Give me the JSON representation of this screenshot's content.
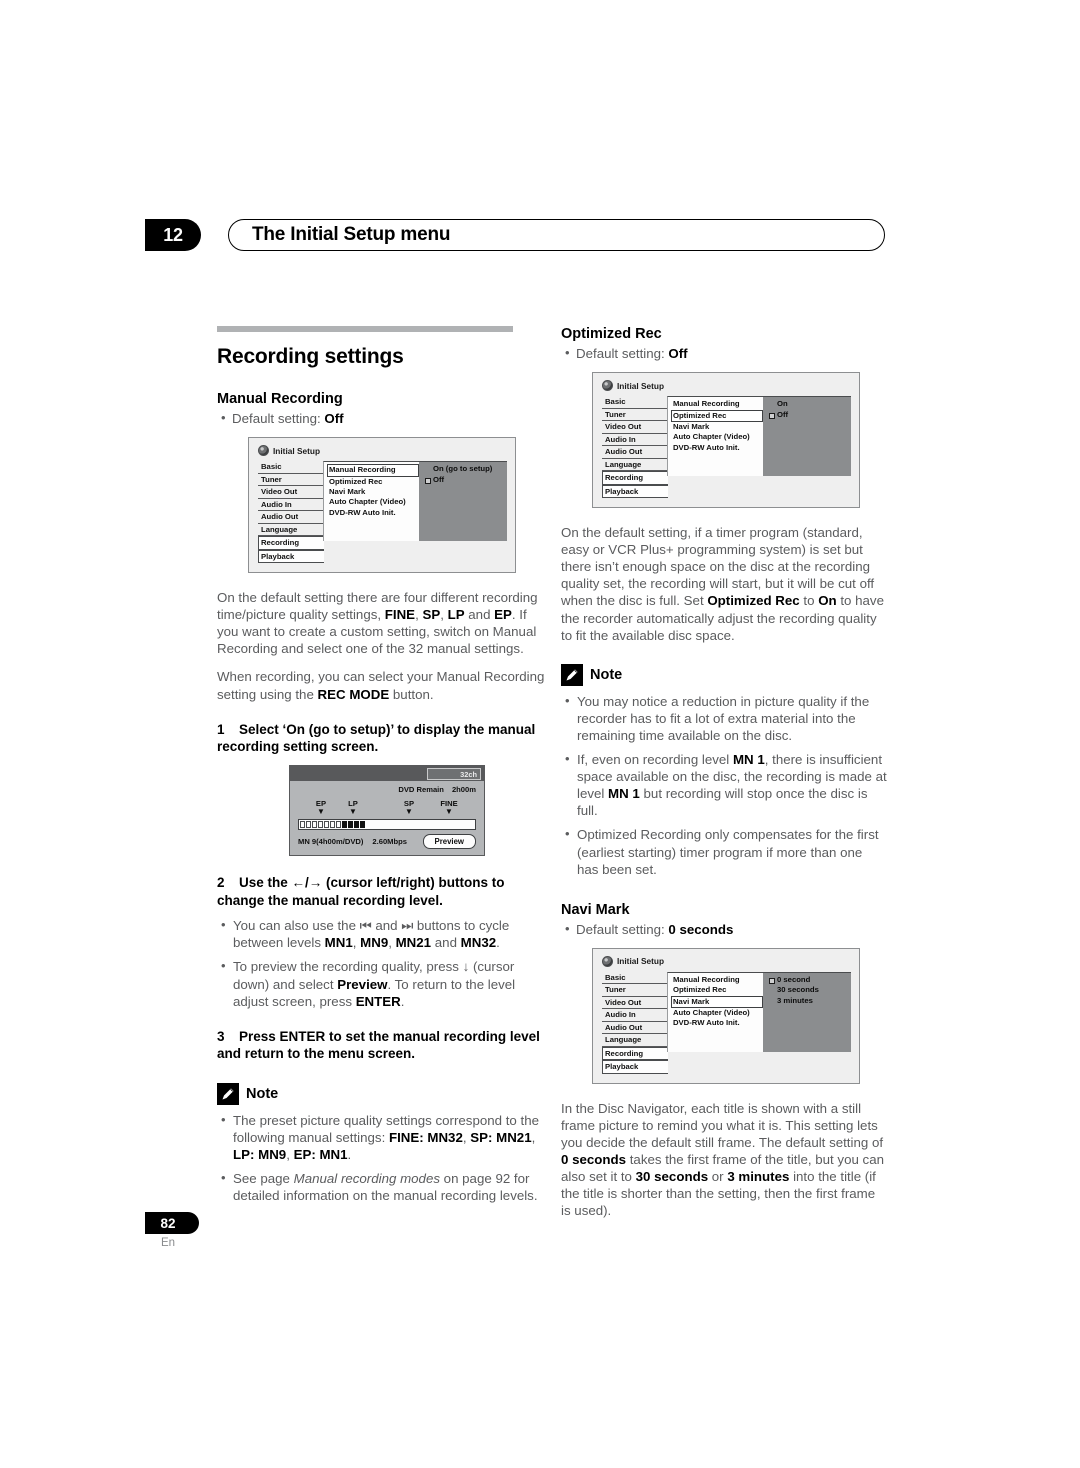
{
  "header": {
    "chapter_number": "12",
    "title": "The Initial Setup menu"
  },
  "footer": {
    "page_number": "82",
    "language_code": "En"
  },
  "left_column": {
    "section_title": "Recording settings",
    "manual_recording": {
      "heading": "Manual Recording",
      "default_setting": "Default setting: ",
      "default_value": "Off",
      "osd": {
        "title": "Initial Setup",
        "categories": [
          "Basic",
          "Tuner",
          "Video Out",
          "Audio In",
          "Audio Out",
          "Language",
          "Recording",
          "Playback"
        ],
        "selected_category": "Recording",
        "items": [
          "Manual Recording",
          "Optimized Rec",
          "Navi Mark",
          "Auto Chapter (Video)",
          "DVD-RW Auto Init."
        ],
        "selected_item": "Manual Recording",
        "options": [
          "On (go to setup)",
          "Off"
        ],
        "selected_option": "Off"
      },
      "para1_a": "On the default setting there are four different recording time/picture quality settings, ",
      "para1_fine": "FINE",
      "para1_b": ", ",
      "para1_sp": "SP",
      "para1_c": ", ",
      "para1_lp": "LP",
      "para1_d": " and ",
      "para1_ep": "EP",
      "para1_e": ". If you want to create a custom setting, switch on Manual Recording and select one of the 32 manual settings.",
      "para2_a": "When recording, you can select your Manual Recording setting using the ",
      "para2_recmode": "REC MODE",
      "para2_b": " button.",
      "step1_num": "1",
      "step1_text": "Select ‘On (go to setup)’ to display the manual recording setting screen.",
      "level_screen": {
        "channel": "32ch",
        "remain_label": "DVD Remain",
        "remain_value": "2h00m",
        "marks": [
          "EP",
          "LP",
          "SP",
          "FINE"
        ],
        "mode_label": "MN 9(4h00m/DVD)",
        "bitrate": "2.60Mbps",
        "preview_button": "Preview",
        "empty_segments": 7,
        "filled_segments": 4
      },
      "step2_num": "2",
      "step2_text": "Use the ←/→ (cursor left/right) buttons to change the manual recording level.",
      "step2_bullet1_a": "You can also use the ⏮ and ⏭ buttons to cycle between levels ",
      "step2_bullet1_mn1": "MN1",
      "step2_bullet1_b": ", ",
      "step2_bullet1_mn9": "MN9",
      "step2_bullet1_c": ", ",
      "step2_bullet1_mn21": "MN21",
      "step2_bullet1_d": " and ",
      "step2_bullet1_mn32": "MN32",
      "step2_bullet1_e": ".",
      "step2_bullet2_a": "To preview the recording quality, press ↓ (cursor down) and select ",
      "step2_bullet2_preview": "Preview",
      "step2_bullet2_b": ". To return to the level adjust screen, press ",
      "step2_bullet2_enter": "ENTER",
      "step2_bullet2_c": ".",
      "step3_num": "3",
      "step3_text": "Press ENTER to set the manual recording level and return to the menu screen.",
      "note_label": "Note",
      "note1_a": "The preset picture quality settings correspond to the following manual settings: ",
      "note1_fine": "FINE",
      "note1_b": ": ",
      "note1_mn32": "MN32",
      "note1_c": ", ",
      "note1_sp": "SP",
      "note1_d": ": ",
      "note1_mn21": "MN21",
      "note1_e": ", ",
      "note1_lp": "LP",
      "note1_f": ": ",
      "note1_mn9": "MN9",
      "note1_g": ", ",
      "note1_ep": "EP",
      "note1_h": ": ",
      "note1_mn1": "MN1",
      "note1_i": ".",
      "note2_a": "See page ",
      "note2_italic": "Manual recording modes",
      "note2_b": " on page 92 for detailed information on the manual recording levels."
    }
  },
  "right_column": {
    "optimized_rec": {
      "heading": "Optimized Rec",
      "default_setting": "Default setting: ",
      "default_value": "Off",
      "osd": {
        "title": "Initial Setup",
        "categories": [
          "Basic",
          "Tuner",
          "Video Out",
          "Audio In",
          "Audio Out",
          "Language",
          "Recording",
          "Playback"
        ],
        "selected_category": "Recording",
        "items": [
          "Manual Recording",
          "Optimized Rec",
          "Navi Mark",
          "Auto Chapter (Video)",
          "DVD-RW Auto Init."
        ],
        "selected_item": "Optimized Rec",
        "options": [
          "On",
          "Off"
        ],
        "selected_option": "Off"
      },
      "para_a": "On the default setting, if a timer program (standard, easy or VCR Plus+ programming system) is set but there isn’t enough space on the disc at the recording quality set, the recording will start, but it will be cut off when the disc is full. Set ",
      "para_optrec": "Optimized Rec",
      "para_b": " to ",
      "para_on": "On",
      "para_c": " to have the recorder automatically adjust the recording quality to fit the available disc space.",
      "note_label": "Note",
      "note1": "You may notice a reduction in picture quality if the recorder has to fit a lot of extra material into the remaining time available on the disc.",
      "note2_a": "If, even on recording level ",
      "note2_mn1": "MN 1",
      "note2_b": ", there is insufficient space available on the disc, the recording is made at level ",
      "note2_mn1b": "MN 1",
      "note2_c": " but recording will stop once the disc is full.",
      "note3": "Optimized Recording only compensates for the first (earliest starting) timer program if more than one has been set."
    },
    "navi_mark": {
      "heading": "Navi Mark",
      "default_setting": "Default setting: ",
      "default_value": "0 seconds",
      "osd": {
        "title": "Initial Setup",
        "categories": [
          "Basic",
          "Tuner",
          "Video Out",
          "Audio In",
          "Audio Out",
          "Language",
          "Recording",
          "Playback"
        ],
        "selected_category": "Recording",
        "items": [
          "Manual Recording",
          "Optimized Rec",
          "Navi Mark",
          "Auto Chapter (Video)",
          "DVD-RW Auto Init."
        ],
        "selected_item": "Navi Mark",
        "options": [
          "0 second",
          "30 seconds",
          "3 minutes"
        ],
        "selected_option": "0 second"
      },
      "para_a": "In the Disc Navigator, each title is shown with a still frame picture to remind you what it is. This setting lets you decide the default still frame. The default setting of ",
      "para_zero": "0 seconds",
      "para_b": " takes the first frame of the title, but you can also set it to ",
      "para_30": "30 seconds",
      "para_c": " or ",
      "para_3m": "3 minutes",
      "para_d": " into the title (if the title is shorter than the setting, then the first frame is used)."
    }
  }
}
